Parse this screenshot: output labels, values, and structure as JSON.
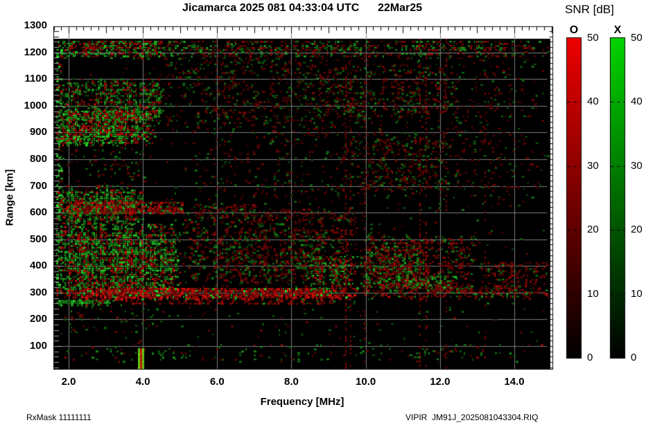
{
  "title": "Jicamarca 2025 081 04:33:04 UTC      22Mar25",
  "footer": {
    "left": "RxMask 11111111",
    "right": "VIPIR  JM91J_2025081043304.RIQ"
  },
  "colorbar": {
    "title": "SNR [dB]",
    "min": 0,
    "max": 50,
    "ticks": [
      0,
      10,
      20,
      30,
      40,
      50
    ],
    "bars": [
      {
        "label": "O",
        "color": "#ee0000"
      },
      {
        "label": "X",
        "color": "#00d400"
      }
    ]
  },
  "chart_data": {
    "type": "heatmap",
    "title": "Jicamarca 2025 081 04:33:04 UTC      22Mar25",
    "xlabel": "Frequency [MHz]",
    "ylabel": "Range [km]",
    "xlim": [
      1.6,
      15.0
    ],
    "ylim": [
      15,
      1300
    ],
    "x_ticks": [
      2,
      4,
      6,
      8,
      10,
      12,
      14
    ],
    "x_tick_labels": [
      "2.0",
      "4.0",
      "6.0",
      "8.0",
      "10.0",
      "12.0",
      "14.0"
    ],
    "y_ticks": [
      100,
      200,
      300,
      400,
      500,
      600,
      700,
      800,
      900,
      1000,
      1100,
      1200,
      1300
    ],
    "y_tick_labels": [
      "100",
      "200",
      "300",
      "400",
      "500",
      "600",
      "700",
      "800",
      "900",
      "1000",
      "1100",
      "1200",
      "1300"
    ],
    "grid": true,
    "grid_color": "#7d7d7d",
    "background": "#000000",
    "legend_position": "right",
    "series": [
      {
        "name": "O-mode SNR",
        "color": "#ee0000"
      },
      {
        "name": "X-mode SNR",
        "color": "#00d400"
      }
    ],
    "features": [
      {
        "name": "noise-floor",
        "f": [
          1.6,
          15.0
        ],
        "r": [
          15,
          1255
        ],
        "density": 0.025,
        "green": 0.5,
        "bright": 0.3
      },
      {
        "name": "upper-right-dim-haze",
        "f": [
          5.0,
          15.0
        ],
        "r": [
          620,
          1255
        ],
        "density": 0.1,
        "green": 0.28,
        "bright": 0.33
      },
      {
        "name": "upper-mid-dim-haze",
        "f": [
          4.0,
          9.0
        ],
        "r": [
          900,
          1250
        ],
        "density": 0.14,
        "green": 0.35,
        "bright": 0.35
      },
      {
        "name": "top-band-1240",
        "f": [
          1.6,
          15.0
        ],
        "r": [
          1185,
          1255
        ],
        "density": 0.38,
        "green": 0.45,
        "bright": 0.5
      },
      {
        "name": "top-band-1240-left",
        "f": [
          1.6,
          4.6
        ],
        "r": [
          1180,
          1255
        ],
        "density": 0.6,
        "green": 0.5,
        "bright": 0.7
      },
      {
        "name": "scatter-1000",
        "f": [
          1.6,
          4.6
        ],
        "r": [
          930,
          1110
        ],
        "density": 0.5,
        "green": 0.55,
        "bright": 0.62
      },
      {
        "name": "layer-900",
        "f": [
          1.6,
          4.4
        ],
        "r": [
          855,
          1005
        ],
        "density": 0.68,
        "green": 0.58,
        "bright": 0.78
      },
      {
        "name": "layer-900-bright-edge",
        "f": [
          1.6,
          2.8
        ],
        "r": [
          855,
          895
        ],
        "density": 0.9,
        "green": 0.65,
        "bright": 0.95
      },
      {
        "name": "midleft-sparse",
        "f": [
          1.6,
          4.2
        ],
        "r": [
          700,
          860
        ],
        "density": 0.1,
        "green": 0.5,
        "bright": 0.38
      },
      {
        "name": "layer-650",
        "f": [
          1.6,
          4.0
        ],
        "r": [
          545,
          710
        ],
        "density": 0.62,
        "green": 0.66,
        "bright": 0.7
      },
      {
        "name": "red-band-620",
        "f": [
          1.6,
          5.2
        ],
        "r": [
          595,
          648
        ],
        "density": 0.85,
        "green": 0.22,
        "bright": 0.88
      },
      {
        "name": "red-band-620-ext",
        "f": [
          5.2,
          7.2
        ],
        "r": [
          600,
          640
        ],
        "density": 0.3,
        "green": 0.2,
        "bright": 0.5
      },
      {
        "name": "main-blob-400",
        "f": [
          1.6,
          5.0
        ],
        "r": [
          285,
          565
        ],
        "density": 0.72,
        "green": 0.58,
        "bright": 0.78
      },
      {
        "name": "mid-haze",
        "f": [
          5.0,
          9.8
        ],
        "r": [
          320,
          630
        ],
        "density": 0.33,
        "green": 0.3,
        "bright": 0.5
      },
      {
        "name": "red-layer-300",
        "f": [
          1.6,
          9.8
        ],
        "r": [
          276,
          325
        ],
        "density": 0.97,
        "green": 0.12,
        "bright": 0.95
      },
      {
        "name": "red-layer-300-right",
        "f": [
          9.8,
          15.0
        ],
        "r": [
          280,
          335
        ],
        "density": 0.5,
        "green": 0.22,
        "bright": 0.6
      },
      {
        "name": "green-underline-270",
        "f": [
          1.6,
          3.2
        ],
        "r": [
          255,
          280
        ],
        "density": 0.8,
        "green": 0.85,
        "bright": 0.85
      },
      {
        "name": "red-underline-265",
        "f": [
          3.2,
          9.5
        ],
        "r": [
          258,
          278
        ],
        "density": 0.5,
        "green": 0.1,
        "bright": 0.7
      },
      {
        "name": "green-streak-340",
        "f": [
          10.2,
          12.5
        ],
        "r": [
          318,
          370
        ],
        "density": 0.55,
        "green": 0.75,
        "bright": 0.8
      },
      {
        "name": "green-patch-9mhz",
        "f": [
          8.4,
          9.8
        ],
        "r": [
          300,
          445
        ],
        "density": 0.45,
        "green": 0.55,
        "bright": 0.72
      },
      {
        "name": "green-patch-10mhz",
        "f": [
          9.8,
          11.7
        ],
        "r": [
          315,
          485
        ],
        "density": 0.45,
        "green": 0.5,
        "bright": 0.72
      },
      {
        "name": "right-red-haze",
        "f": [
          9.8,
          13.0
        ],
        "r": [
          300,
          520
        ],
        "density": 0.38,
        "green": 0.22,
        "bright": 0.5
      },
      {
        "name": "far-right-red",
        "f": [
          13.0,
          15.0
        ],
        "r": [
          290,
          430
        ],
        "density": 0.42,
        "green": 0.15,
        "bright": 0.55
      },
      {
        "name": "upper-red-patch",
        "f": [
          9.9,
          12.4
        ],
        "r": [
          680,
          900
        ],
        "density": 0.22,
        "green": 0.3,
        "bright": 0.4
      },
      {
        "name": "upper-speckle-1050",
        "f": [
          8.5,
          12.5
        ],
        "r": [
          950,
          1160
        ],
        "density": 0.2,
        "green": 0.4,
        "bright": 0.45
      },
      {
        "name": "left-edge-column",
        "f": [
          1.6,
          1.8
        ],
        "r": [
          285,
          1255
        ],
        "density": 0.5,
        "green": 0.8,
        "bright": 0.85
      },
      {
        "name": "bottom-row-sparse",
        "f": [
          1.6,
          15.0
        ],
        "r": [
          40,
          115
        ],
        "density": 0.07,
        "green": 0.65,
        "bright": 0.5
      },
      {
        "name": "bottom-left-sparse",
        "f": [
          1.6,
          4.6
        ],
        "r": [
          120,
          265
        ],
        "density": 0.06,
        "green": 0.55,
        "bright": 0.42
      }
    ],
    "rfi_lines": [
      {
        "f": 9.45,
        "strength": 0.4
      },
      {
        "f": 9.58,
        "strength": 0.3
      },
      {
        "f": 9.95,
        "strength": 0.25
      },
      {
        "f": 11.45,
        "strength": 0.35
      },
      {
        "f": 11.62,
        "strength": 0.25
      },
      {
        "f": 12.15,
        "strength": 0.2
      },
      {
        "f": 13.2,
        "strength": 0.18
      }
    ],
    "tx_spike": {
      "r": [
        18,
        92
      ],
      "bars": [
        {
          "f": [
            3.86,
            3.92
          ],
          "color": "green"
        },
        {
          "f": [
            3.92,
            3.97
          ],
          "color": "red"
        },
        {
          "f": [
            3.97,
            4.03
          ],
          "color": "green"
        }
      ]
    }
  }
}
